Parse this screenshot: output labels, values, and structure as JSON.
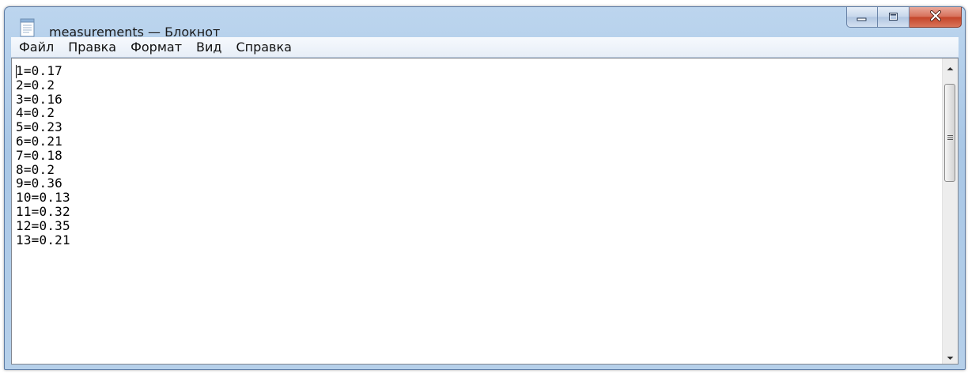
{
  "window": {
    "title": "measurements — Блокнот"
  },
  "menu": {
    "items": [
      "Файл",
      "Правка",
      "Формат",
      "Вид",
      "Справка"
    ]
  },
  "editor": {
    "lines": [
      "1=0.17",
      "2=0.2",
      "3=0.16",
      "4=0.2",
      "5=0.23",
      "6=0.21",
      "7=0.18",
      "8=0.2",
      "9=0.36",
      "10=0.13",
      "11=0.32",
      "12=0.35",
      "13=0.21"
    ]
  },
  "icons": {
    "app": "notepad-icon",
    "minimize": "minimize-icon",
    "maximize": "maximize-icon",
    "close": "close-icon",
    "scroll_up": "arrow-up-icon",
    "scroll_down": "arrow-down-icon"
  },
  "colors": {
    "titlebar": "#bcd5ee",
    "close_button": "#c4452a"
  }
}
